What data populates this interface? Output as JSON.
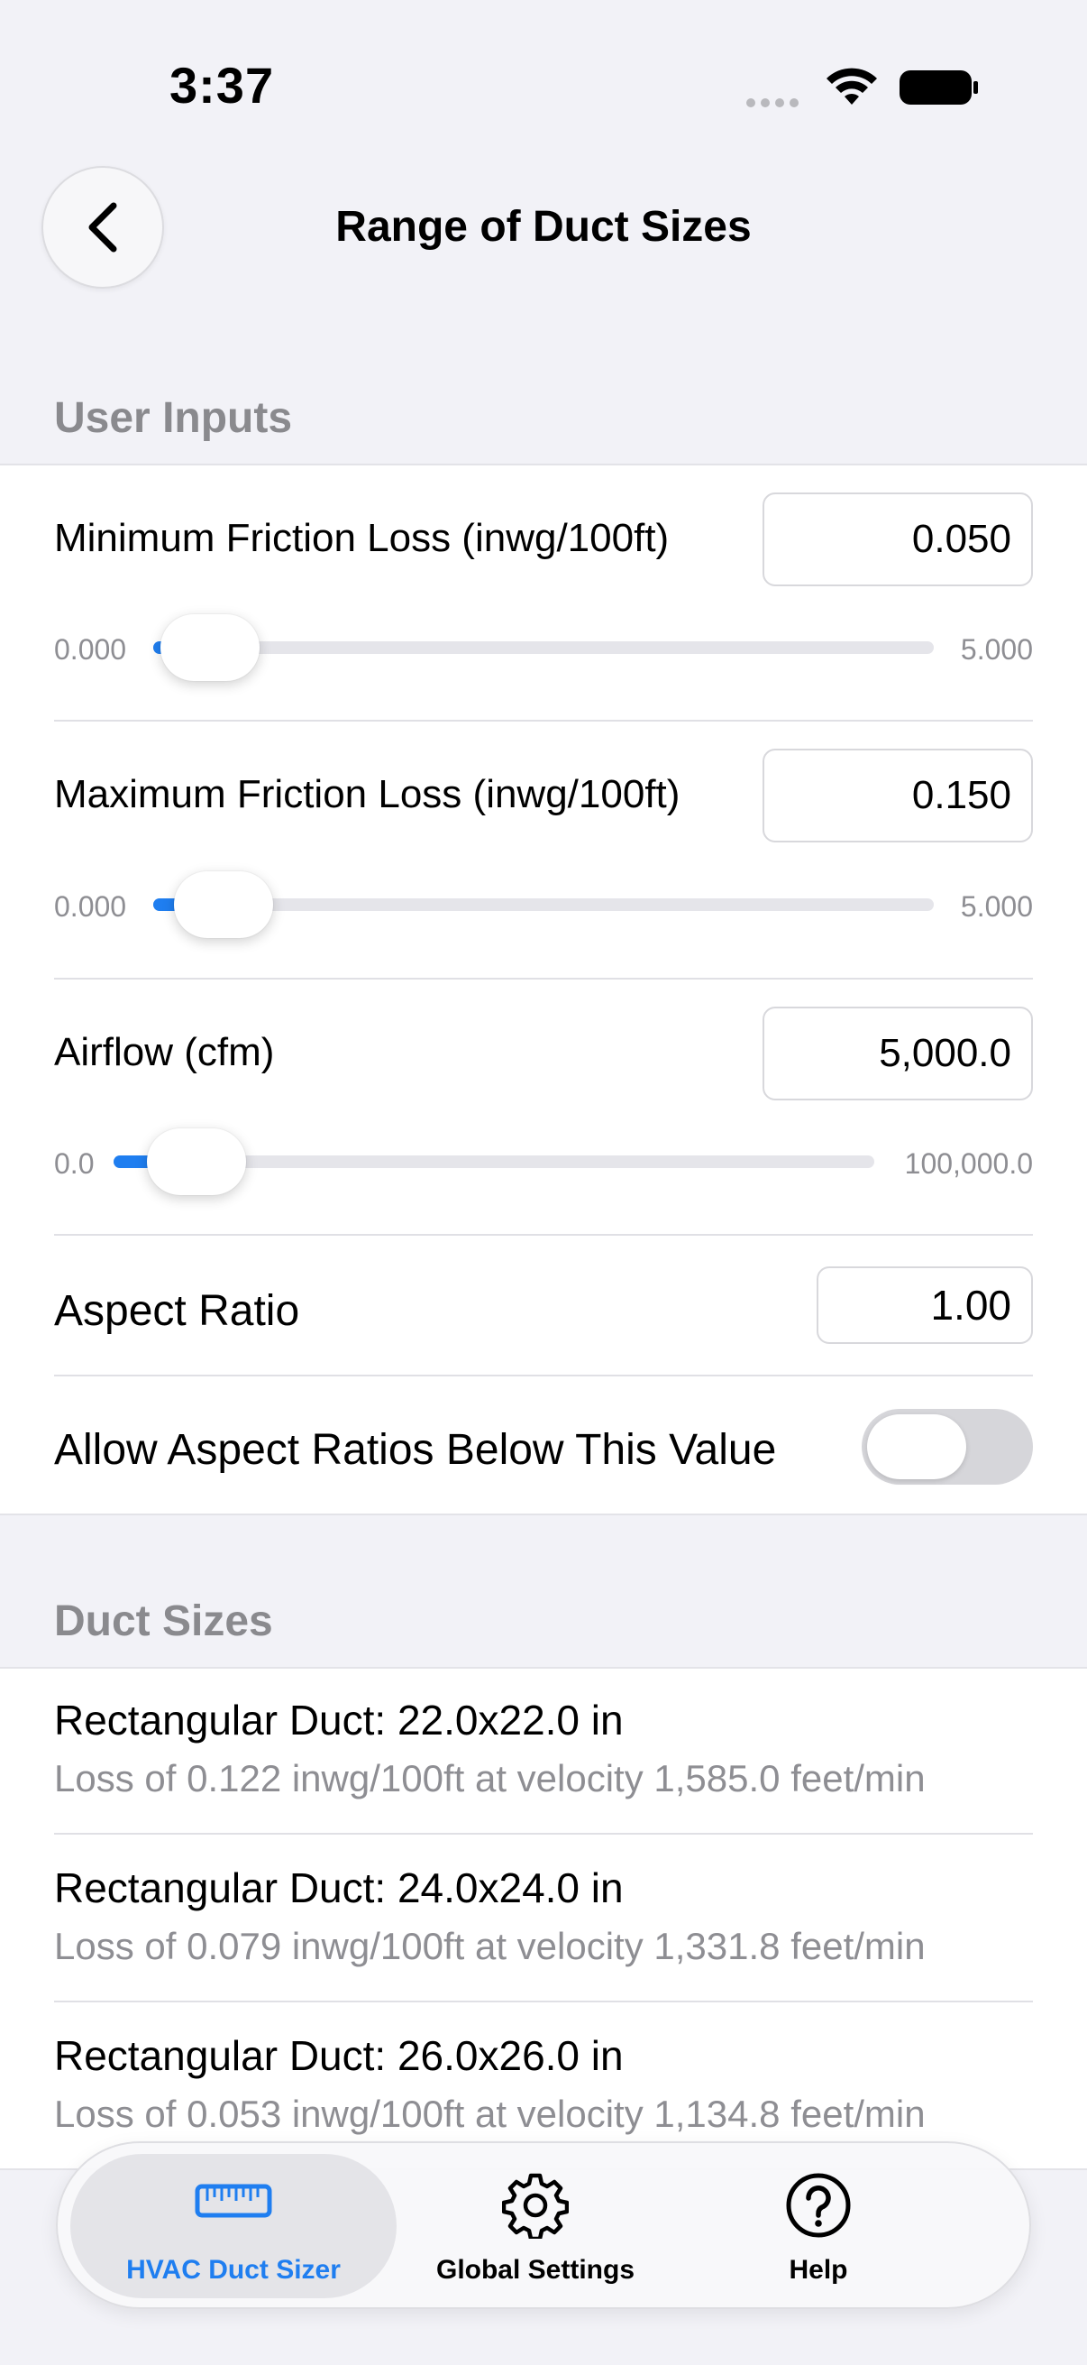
{
  "status": {
    "time": "3:37"
  },
  "nav": {
    "title": "Range of Duct Sizes"
  },
  "user_inputs": {
    "header": "User Inputs",
    "min_friction": {
      "label": "Minimum Friction Loss (inwg/100ft)",
      "value": "0.050",
      "min": "0.000",
      "max": "5.000",
      "fraction": 0.01
    },
    "max_friction": {
      "label": "Maximum Friction Loss (inwg/100ft)",
      "value": "0.150",
      "min": "0.000",
      "max": "5.000",
      "fraction": 0.03
    },
    "airflow": {
      "label": "Airflow (cfm)",
      "value": "5,000.0",
      "min": "0.0",
      "max": "100,000.0",
      "fraction": 0.05
    },
    "aspect_ratio": {
      "label": "Aspect Ratio",
      "value": "1.00"
    },
    "allow_below": {
      "label": "Allow Aspect Ratios Below This Value",
      "on": false
    }
  },
  "duct_sizes": {
    "header": "Duct Sizes",
    "items": [
      {
        "title": "Rectangular Duct: 22.0x22.0 in",
        "subtitle": "Loss of 0.122 inwg/100ft at velocity 1,585.0 feet/min"
      },
      {
        "title": "Rectangular Duct: 24.0x24.0 in",
        "subtitle": "Loss of 0.079 inwg/100ft at velocity 1,331.8 feet/min"
      },
      {
        "title": "Rectangular Duct: 26.0x26.0 in",
        "subtitle": "Loss of 0.053 inwg/100ft at velocity 1,134.8 feet/min"
      }
    ]
  },
  "tabs": [
    {
      "label": "HVAC Duct Sizer",
      "icon": "ruler-icon",
      "active": true
    },
    {
      "label": "Global Settings",
      "icon": "gear-icon",
      "active": false
    },
    {
      "label": "Help",
      "icon": "question-circle-icon",
      "active": false
    }
  ],
  "colors": {
    "accent": "#1f7ef0",
    "secondary_text": "#8e8e93",
    "background": "#f2f2f7"
  }
}
